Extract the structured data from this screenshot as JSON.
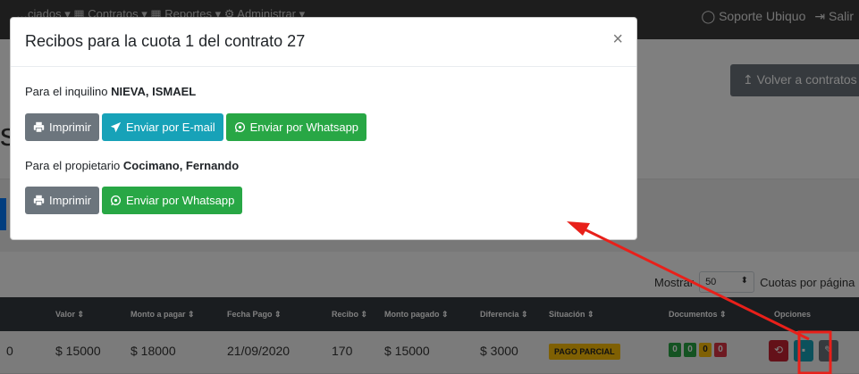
{
  "topnav": {
    "left_text": "…ciados ▾   ▦ Contratos ▾   ▦ Reportes ▾   ⚙ Administrar ▾",
    "support": "Soporte Ubiquo",
    "logout": "Salir"
  },
  "page": {
    "back_button": "Volver a contratos",
    "left_char": "s"
  },
  "pagination": {
    "show_label": "Mostrar",
    "page_size": "50",
    "suffix": "Cuotas por página"
  },
  "table": {
    "headers": [
      "Valor ⇕",
      "Monto a pagar ⇕",
      "Fecha Pago ⇕",
      "Recibo ⇕",
      "Monto pagado ⇕",
      "Diferencia ⇕",
      "Situación ⇕",
      "Documentos ⇕",
      "Opciones"
    ],
    "row": {
      "first_cut": "0",
      "valor": "$ 15000",
      "monto_pagar": "$ 18000",
      "fecha_pago": "21/09/2020",
      "recibo": "170",
      "monto_pagado": "$ 15000",
      "diferencia": "$ 3000",
      "situacion": "PAGO PARCIAL",
      "documentos": [
        "0",
        "0",
        "0",
        "0"
      ]
    }
  },
  "modal": {
    "title": "Recibos para la cuota 1 del contrato 27",
    "close": "×",
    "tenant_prefix": "Para el inquilino",
    "tenant_name": "NIEVA, ISMAEL",
    "owner_prefix": "Para el propietario",
    "owner_name": "Cocimano, Fernando",
    "print_label": "Imprimir",
    "email_label": "Enviar por E-mail",
    "whatsapp_label": "Enviar por Whatsapp"
  },
  "colors": {
    "gray_button": "#6c757d",
    "teal_button": "#17a2b8",
    "green_button": "#28a745",
    "annotation_red": "#e8201a",
    "badge_yellow": "#ffc107"
  }
}
